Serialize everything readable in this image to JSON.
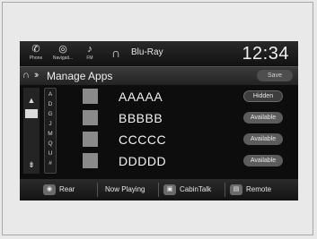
{
  "status_bar": {
    "items": [
      {
        "label": "Phone",
        "icon": "phone-icon"
      },
      {
        "label": "Navigati...",
        "icon": "navigation-icon"
      },
      {
        "label": "FM",
        "icon": "radio-icon"
      }
    ],
    "source_icon": "headphones-icon",
    "source_label": "Blu-Ray",
    "clock": "12:34"
  },
  "title_bar": {
    "title": "Manage Apps",
    "save_label": "Save"
  },
  "alpha_index": [
    "A",
    "D",
    "G",
    "J",
    "M",
    "Q",
    "U",
    "#"
  ],
  "apps": [
    {
      "name": "AAAAA",
      "status": "Hidden"
    },
    {
      "name": "BBBBB",
      "status": "Available"
    },
    {
      "name": "CCCCC",
      "status": "Available"
    },
    {
      "name": "DDDDD",
      "status": "Available"
    }
  ],
  "bottom_bar": {
    "items": [
      {
        "label": "Rear"
      },
      {
        "label": "Now Playing"
      },
      {
        "label": "CabinTalk"
      },
      {
        "label": "Remote"
      }
    ]
  }
}
